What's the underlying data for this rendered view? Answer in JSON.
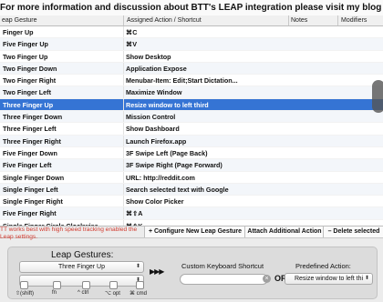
{
  "banner": "For more information and discussion about BTT's LEAP integration please visit my blog (click here)",
  "columns": [
    "eap Gesture",
    "Assigned Action / Shortcut",
    "Notes",
    "Modifiers"
  ],
  "rows": [
    {
      "gesture": "Finger Up",
      "action": "⌘C"
    },
    {
      "gesture": "Five Finger Up",
      "action": "⌘V"
    },
    {
      "gesture": "Two Finger Up",
      "action": "Show Desktop"
    },
    {
      "gesture": "Two Finger Down",
      "action": "Application Expose"
    },
    {
      "gesture": "Two Finger Right",
      "action": "Menubar-Item: Edit;Start Dictation..."
    },
    {
      "gesture": "Two Finger Left",
      "action": "Maximize Window"
    },
    {
      "gesture": "Three Finger Up",
      "action": "Resize window to left third",
      "selected": true
    },
    {
      "gesture": "Three Finger Down",
      "action": "Mission Control"
    },
    {
      "gesture": "Three Finger Left",
      "action": "Show Dashboard"
    },
    {
      "gesture": "Three Finger Right",
      "action": "Launch Firefox.app"
    },
    {
      "gesture": "Five Finger Down",
      "action": "3F Swipe Left (Page Back)"
    },
    {
      "gesture": "Five Finger Left",
      "action": "3F Swipe Right (Page Forward)"
    },
    {
      "gesture": "Single Finger Down",
      "action": "URL: http://reddit.com"
    },
    {
      "gesture": "Single Finger Left",
      "action": "Search selected text with Google"
    },
    {
      "gesture": "Single Finger Right",
      "action": "Show Color Picker"
    },
    {
      "gesture": "Five Finger Right",
      "action": "⌘⇧A"
    },
    {
      "gesture": "Single Finger Circle Clockwise",
      "action": "⌘⇧K"
    }
  ],
  "bottom_bar": {
    "hint": "TT works best with high speed tracking enabled the Leap settings.",
    "configure_button": "+ Configure New Leap Gesture",
    "attach_button": "Attach Additional Action",
    "delete_button": "– Delete selected"
  },
  "panel": {
    "gestures_label": "Leap Gestures:",
    "gesture_selected": "Three Finger Up",
    "second_popup": "",
    "arrows": "▶▶▶",
    "shortcut_label": "Custom Keyboard Shortcut",
    "or_label": "OR",
    "predefined_label": "Predefined Action:",
    "predefined_selected": "Resize window to left thi",
    "modifiers": [
      "⇧(shift)",
      "fn",
      "^ ctrl",
      "⌥ opt",
      "⌘ cmd"
    ]
  },
  "colors": {
    "selection": "#3574d4",
    "hint": "#d23a2e"
  }
}
